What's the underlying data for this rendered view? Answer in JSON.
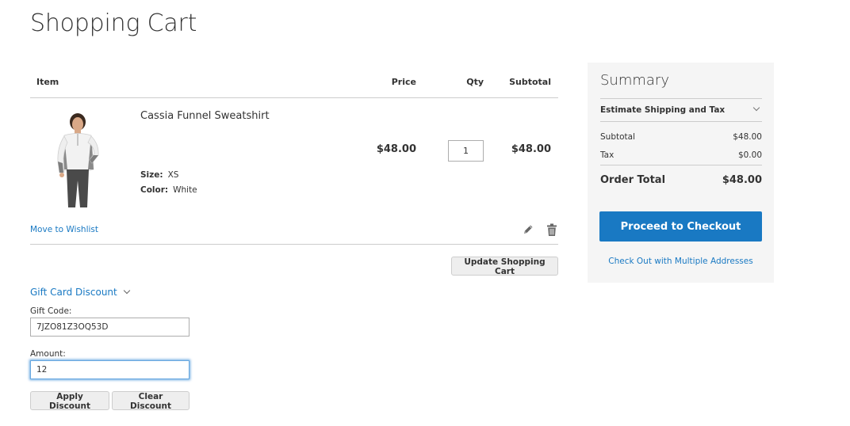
{
  "page": {
    "title": "Shopping Cart"
  },
  "cart": {
    "columns": {
      "item": "Item",
      "price": "Price",
      "qty": "Qty",
      "subtotal": "Subtotal"
    },
    "items": [
      {
        "name": "Cassia Funnel Sweatshirt",
        "options": [
          {
            "label": "Size:",
            "value": "XS"
          },
          {
            "label": "Color:",
            "value": "White"
          }
        ],
        "price": "$48.00",
        "qty": "1",
        "subtotal": "$48.00",
        "move_to_wishlist": "Move to Wishlist",
        "edit_icon": "pencil-icon",
        "delete_icon": "trash-icon"
      }
    ],
    "update_button": "Update Shopping Cart"
  },
  "gift_card": {
    "title": "Gift Card Discount",
    "code_label": "Gift Code:",
    "code_value": "7JZO81Z3OQ53D",
    "amount_label": "Amount:",
    "amount_value": "12",
    "apply_button": "Apply Discount",
    "clear_button": "Clear Discount"
  },
  "summary": {
    "title": "Summary",
    "estimate_shipping": "Estimate Shipping and Tax",
    "subtotal_label": "Subtotal",
    "subtotal_value": "$48.00",
    "tax_label": "Tax",
    "tax_value": "$0.00",
    "order_total_label": "Order Total",
    "order_total_value": "$48.00",
    "checkout_button": "Proceed to Checkout",
    "multi_address_link": "Check Out with Multiple Addresses"
  },
  "colors": {
    "accent": "#1979c3",
    "summary_bg": "#f5f5f5",
    "button_gray": "#eeeeee"
  }
}
